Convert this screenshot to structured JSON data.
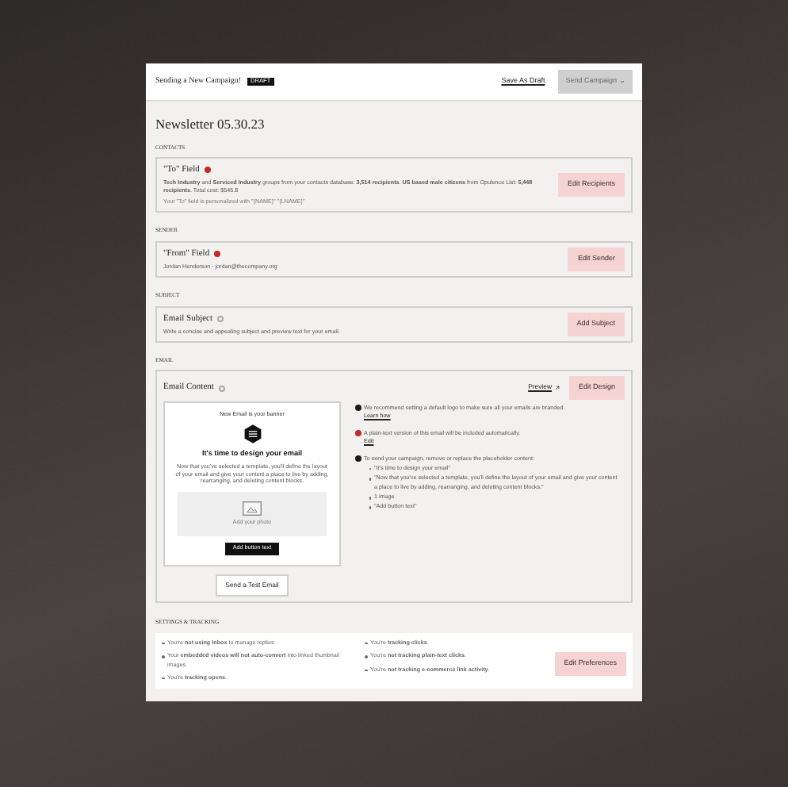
{
  "header": {
    "title": "Sending a New Campaign!",
    "badge": "DRAFT",
    "save_link": "Save As Draft",
    "send_button": {
      "label": "Send Campaign",
      "disabled": true
    }
  },
  "campaign_title": "Newsletter 05.30.23",
  "sections": [
    {
      "heading": "CONTACTS",
      "field": "\"To\" Field",
      "required": true,
      "lines": [
        "**Tech Industry** and **Serviced Industry** groups from your contacts database: **3,514 recipients**. **US based male citizens** from Opulence List: **5,448 recipients**. Total cost: $545.8",
        "Your \"To\" field is personalized with \"{NAME}\" \"{LNAME}\""
      ],
      "button": "Edit Recipients"
    },
    {
      "heading": "SENDER",
      "field": "\"From\" Field",
      "required": true,
      "lines": [
        "Jordan Henderson - jordan@thecompany.org"
      ],
      "button": "Edit Sender"
    },
    {
      "heading": "SUBJECT",
      "field": "Email Subject",
      "required": false,
      "lines": [
        "Write a concise and appealing subject and preview text for your email."
      ],
      "button": "Add Subject"
    }
  ],
  "email": {
    "heading": "EMAIL",
    "field": "Email Content",
    "required": false,
    "preview_link": "Preview",
    "button": "Edit Design",
    "preview": {
      "banner": "New Email is your banner",
      "headline": "It's time to design your email",
      "body": "Now that you've selected a template, you'll define the layout of your email and give your content a place to live by adding, rearranging, and deleting content blocks.",
      "photo_caption": "Add your photo",
      "cta": "Add button text"
    },
    "test_button": "Send a Test Email",
    "notes": [
      {
        "color": "#1a1a1a",
        "text": "We recommend setting a default logo to make sure all your emails are branded.",
        "link": "Learn how"
      },
      {
        "color": "#c62828",
        "text": "A plain-text version of this email will be included automatically.",
        "link": "Edit"
      },
      {
        "color": "#1a1a1a",
        "text": "To send your campaign, remove or replace the placeholder content:",
        "bullets": [
          "\"It's time to design your email\"",
          "\"Now that you've selected a template, you'll define the layout of your email and give your content a place to live by adding, rearranging, and deleting content blocks.\"",
          "1 image",
          "\"Add button text\""
        ]
      }
    ]
  },
  "settings": {
    "heading": "SETTINGS & TRACKING",
    "columns": [
      [
        "You're **not using Inbox** to manage replies",
        "Your **embedded videos will not auto-convert** into linked thumbnail images.",
        "You're **tracking opens**."
      ],
      [
        "You're **tracking clicks**.",
        "You're **not tracking plain-text clicks**.",
        "You're **not tracking e-commerce link activity**."
      ]
    ],
    "button": "Edit Preferences"
  }
}
